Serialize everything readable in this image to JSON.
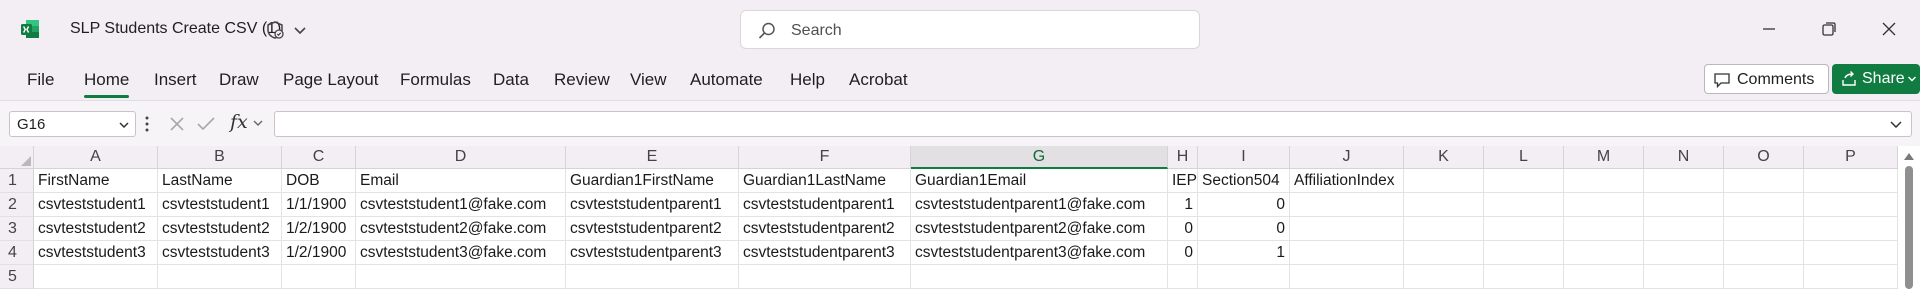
{
  "title_bar": {
    "doc_title": "SLP Students Create CSV (1)",
    "search_placeholder": "Search",
    "accent_color": "#107c41"
  },
  "ribbon": {
    "tabs": [
      "File",
      "Home",
      "Insert",
      "Draw",
      "Page Layout",
      "Formulas",
      "Data",
      "Review",
      "View",
      "Automate",
      "Help",
      "Acrobat"
    ],
    "active_tab": "Home",
    "comments_label": "Comments",
    "share_label": "Share"
  },
  "formula_bar": {
    "name_box": "G16",
    "fx_label": "fx",
    "formula": ""
  },
  "sheet": {
    "selected_column": "G",
    "columns": [
      "A",
      "B",
      "C",
      "D",
      "E",
      "F",
      "G",
      "H",
      "I",
      "J",
      "K",
      "L",
      "M",
      "N",
      "O",
      "P"
    ],
    "rows": [
      {
        "num": "1",
        "cells": [
          "FirstName",
          "LastName",
          "DOB",
          "Email",
          "Guardian1FirstName",
          "Guardian1LastName",
          "Guardian1Email",
          "IEP",
          "Section504",
          "AffiliationIndex"
        ]
      },
      {
        "num": "2",
        "cells": [
          "csvteststudent1",
          "csvteststudent1",
          "1/1/1900",
          "csvteststudent1@fake.com",
          "csvteststudentparent1",
          "csvteststudentparent1",
          "csvteststudentparent1@fake.com",
          "1",
          "0",
          ""
        ]
      },
      {
        "num": "3",
        "cells": [
          "csvteststudent2",
          "csvteststudent2",
          "1/2/1900",
          "csvteststudent2@fake.com",
          "csvteststudentparent2",
          "csvteststudentparent2",
          "csvteststudentparent2@fake.com",
          "0",
          "0",
          ""
        ]
      },
      {
        "num": "4",
        "cells": [
          "csvteststudent3",
          "csvteststudent3",
          "1/2/1900",
          "csvteststudent3@fake.com",
          "csvteststudentparent3",
          "csvteststudentparent3",
          "csvteststudentparent3@fake.com",
          "0",
          "1",
          ""
        ]
      },
      {
        "num": "5",
        "cells": [
          "",
          "",
          "",
          "",
          "",
          "",
          "",
          "",
          "",
          ""
        ]
      }
    ]
  }
}
